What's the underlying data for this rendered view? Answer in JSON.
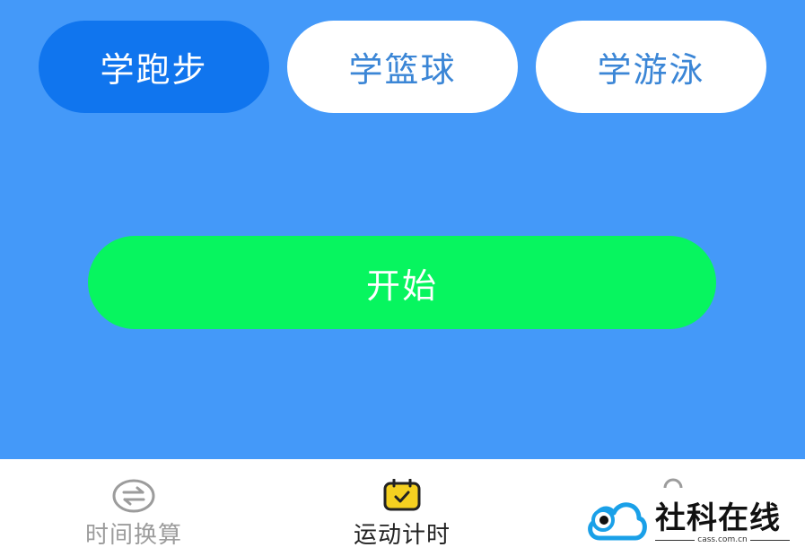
{
  "tabs": [
    {
      "label": "学跑步",
      "active": true
    },
    {
      "label": "学篮球",
      "active": false
    },
    {
      "label": "学游泳",
      "active": false
    }
  ],
  "start_button": {
    "label": "开始"
  },
  "bottom_nav": [
    {
      "label": "时间换算",
      "icon": "exchange-circle-icon",
      "active": false
    },
    {
      "label": "运动计时",
      "icon": "calendar-check-icon",
      "active": true
    }
  ],
  "watermark": {
    "text": "社科在线",
    "subtext": "cass.com.cn"
  },
  "colors": {
    "main_bg": "#4499f9",
    "active_tab": "#1075ee",
    "inactive_tab_text": "#3b86d6",
    "start_button": "#07f55f",
    "nav_active_icon": "#f5d020"
  }
}
